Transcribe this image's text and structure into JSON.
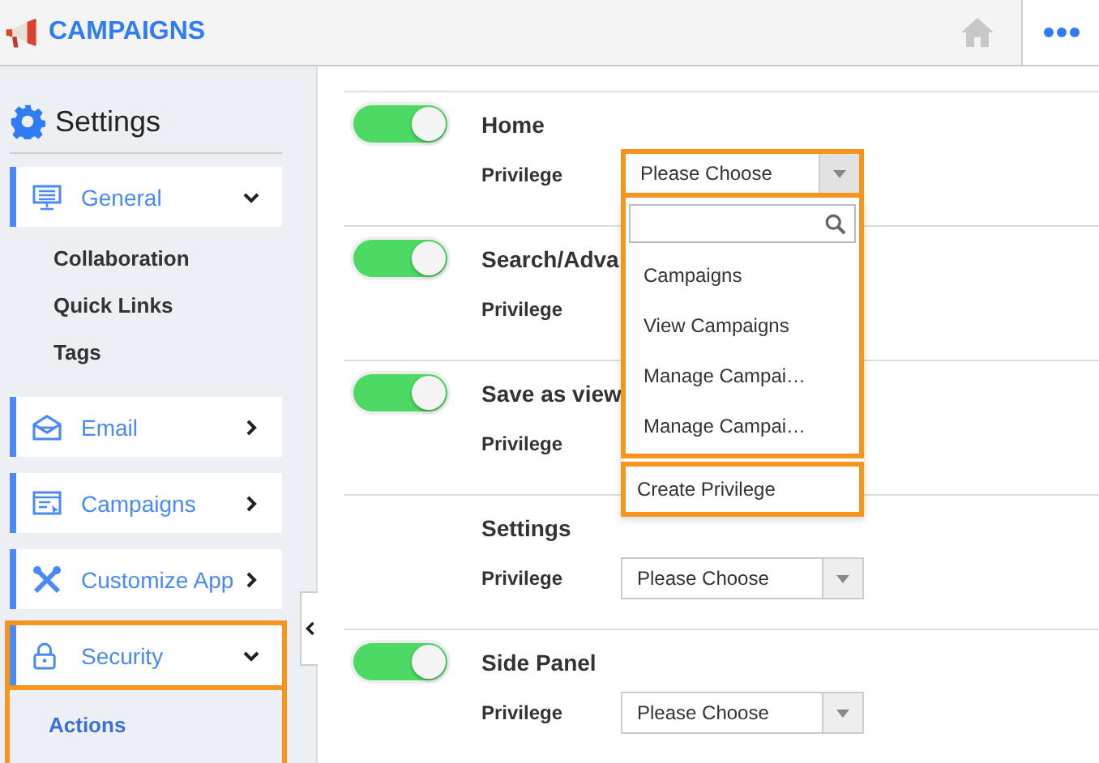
{
  "header": {
    "title": "CAMPAIGNS"
  },
  "sidebar": {
    "title": "Settings",
    "items": [
      {
        "label": "General",
        "expanded": true,
        "highlighted": false,
        "children": [
          {
            "label": "Collaboration",
            "selected": false
          },
          {
            "label": "Quick Links",
            "selected": false
          },
          {
            "label": "Tags",
            "selected": false
          }
        ]
      },
      {
        "label": "Email",
        "expanded": false,
        "highlighted": false
      },
      {
        "label": "Campaigns",
        "expanded": false,
        "highlighted": false
      },
      {
        "label": "Customize App",
        "expanded": false,
        "highlighted": false
      },
      {
        "label": "Security",
        "expanded": true,
        "highlighted": true,
        "children": [
          {
            "label": "Actions",
            "selected": true
          }
        ]
      }
    ]
  },
  "rows": [
    {
      "kind": "toggle",
      "on": true,
      "title": "Home",
      "privilege_label": "Privilege",
      "select": {
        "value": "Please Choose",
        "open": true
      }
    },
    {
      "kind": "toggle",
      "on": true,
      "title": "Search/Adva",
      "privilege_label": "Privilege"
    },
    {
      "kind": "toggle",
      "on": true,
      "title": "Save as view",
      "privilege_label": "Privilege"
    },
    {
      "kind": "plain",
      "title": "Settings",
      "privilege_label": "Privilege",
      "select": {
        "value": "Please Choose",
        "open": false
      }
    },
    {
      "kind": "toggle",
      "on": true,
      "title": "Side Panel",
      "privilege_label": "Privilege",
      "select": {
        "value": "Please Choose",
        "open": false
      }
    }
  ],
  "dropdown": {
    "highlighted": true,
    "options": [
      "Campaigns",
      "View Campaigns",
      "Manage Campai…",
      "Manage Campai…"
    ],
    "footer": "Create Privilege"
  }
}
